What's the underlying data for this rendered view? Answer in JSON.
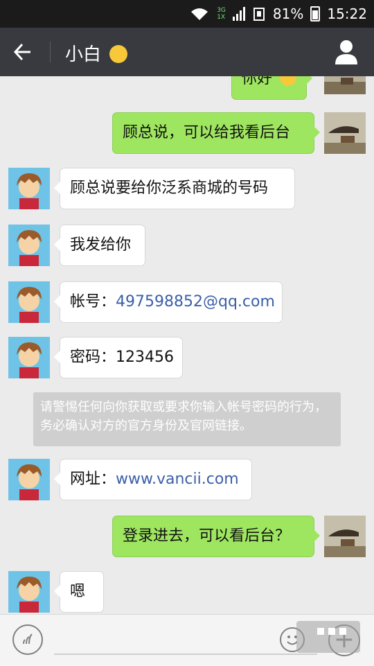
{
  "status_bar": {
    "network": "3G",
    "network2": "1X",
    "battery": "81%",
    "time": "15:22"
  },
  "header": {
    "title": "小白"
  },
  "messages": [
    {
      "side": "out",
      "text": "你好"
    },
    {
      "side": "out",
      "text": "顾总说，可以给我看后台"
    },
    {
      "side": "in",
      "text": "顾总说要给你泛系商城的号码"
    },
    {
      "side": "in",
      "text": "我发给你"
    },
    {
      "side": "in",
      "label": "帐号：",
      "link": "497598852@qq.com"
    },
    {
      "side": "in",
      "text": "密码：123456"
    },
    {
      "side": "in",
      "label": "网址：",
      "link": "www.vancii.com"
    },
    {
      "side": "out",
      "text": "登录进去，可以看后台？"
    },
    {
      "side": "in",
      "text": "嗯"
    }
  ],
  "notice": {
    "text": "请警惕任何向你获取或要求你输入帐号密码的行为，务必确认对方的官方身份及官网链接。"
  },
  "colors": {
    "title_bar": "#393a3f",
    "outgoing_bubble": "#9fe660",
    "incoming_bubble": "#ffffff",
    "link": "#3a5fa8"
  },
  "icons": [
    "back-arrow-icon",
    "profile-icon",
    "voice-icon",
    "emoji-icon",
    "plus-icon"
  ]
}
